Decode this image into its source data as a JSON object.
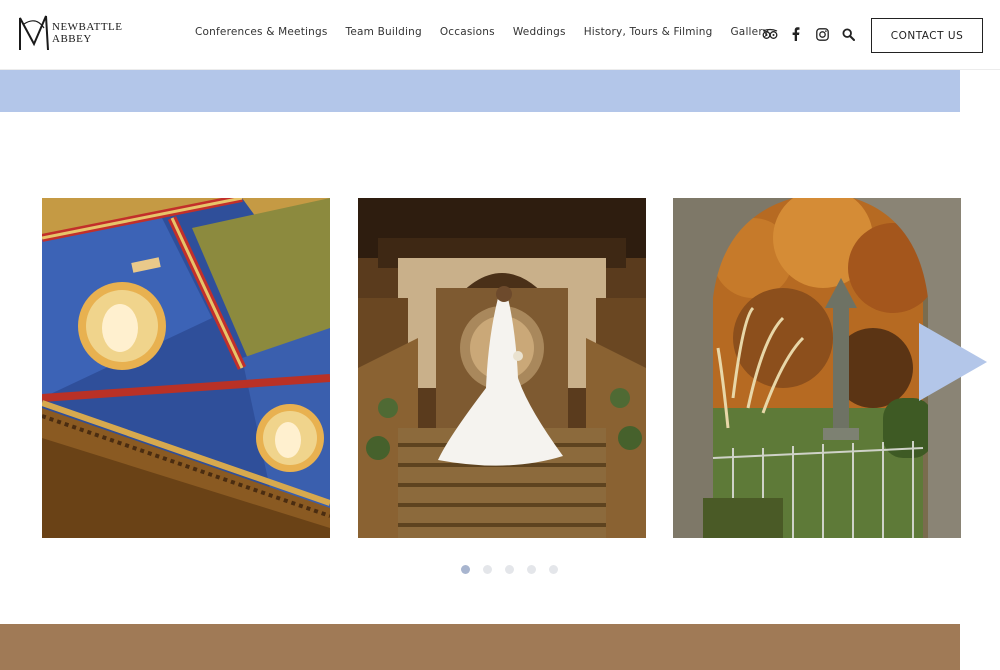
{
  "brand": {
    "line1": "NEWBATTLE",
    "line2": "ABBEY"
  },
  "nav": {
    "items": [
      {
        "label": "Conferences & Meetings"
      },
      {
        "label": "Team Building"
      },
      {
        "label": "Occasions"
      },
      {
        "label": "Weddings"
      },
      {
        "label": "History, Tours & Filming"
      },
      {
        "label": "Gallery"
      }
    ]
  },
  "social": {
    "icons": [
      "tripadvisor-icon",
      "facebook-icon",
      "instagram-icon",
      "search-icon"
    ]
  },
  "header": {
    "contact_label": "CONTACT US"
  },
  "carousel": {
    "slides": [
      {
        "subject": "painted-ceiling"
      },
      {
        "subject": "bride-on-staircase"
      },
      {
        "subject": "garden-through-arch"
      }
    ],
    "dot_count": 5,
    "active_dot": 0,
    "arrow_icon": "next-arrow-icon"
  },
  "colors": {
    "blue_band": "#b3c6e9",
    "brown_band": "#a07a56",
    "arrow": "#b3c6e9",
    "dot_active": "#a8b5cf",
    "dot_inactive": "#e4e6ea"
  }
}
